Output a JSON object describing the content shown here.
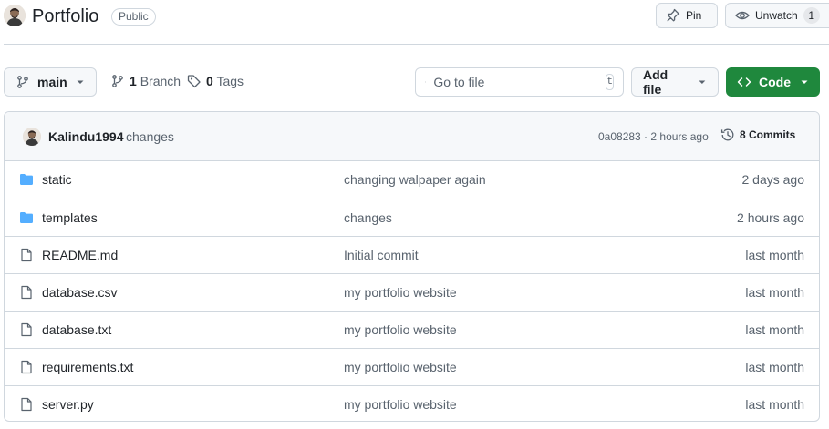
{
  "repo": {
    "name": "Portfolio",
    "visibility": "Public"
  },
  "header": {
    "pin_label": "Pin",
    "unwatch_label": "Unwatch",
    "watch_count": "1"
  },
  "toolbar": {
    "branch_label": "main",
    "branches_count": "1",
    "branches_label": "Branch",
    "tags_count": "0",
    "tags_label": "Tags",
    "search_placeholder": "Go to file",
    "search_shortcut": "t",
    "add_file_label": "Add file",
    "code_label": "Code"
  },
  "latest_commit": {
    "author": "Kalindu1994",
    "message": "changes",
    "hash_time": "0a08283 · 2 hours ago",
    "commits_label": "8 Commits"
  },
  "files": [
    {
      "name": "static",
      "type": "folder",
      "message": "changing walpaper again",
      "date": "2 days ago"
    },
    {
      "name": "templates",
      "type": "folder",
      "message": "changes",
      "date": "2 hours ago"
    },
    {
      "name": "README.md",
      "type": "file",
      "message": "Initial commit",
      "date": "last month"
    },
    {
      "name": "database.csv",
      "type": "file",
      "message": "my portfolio website",
      "date": "last month"
    },
    {
      "name": "database.txt",
      "type": "file",
      "message": "my portfolio website",
      "date": "last month"
    },
    {
      "name": "requirements.txt",
      "type": "file",
      "message": "my portfolio website",
      "date": "last month"
    },
    {
      "name": "server.py",
      "type": "file",
      "message": "my portfolio website",
      "date": "last month"
    }
  ],
  "colors": {
    "folder": "#54aeff",
    "accent_green": "#1f883d",
    "border": "#d0d7de",
    "muted_text": "#59636e"
  },
  "icons": {
    "folder": "folder-icon",
    "file": "file-icon"
  }
}
